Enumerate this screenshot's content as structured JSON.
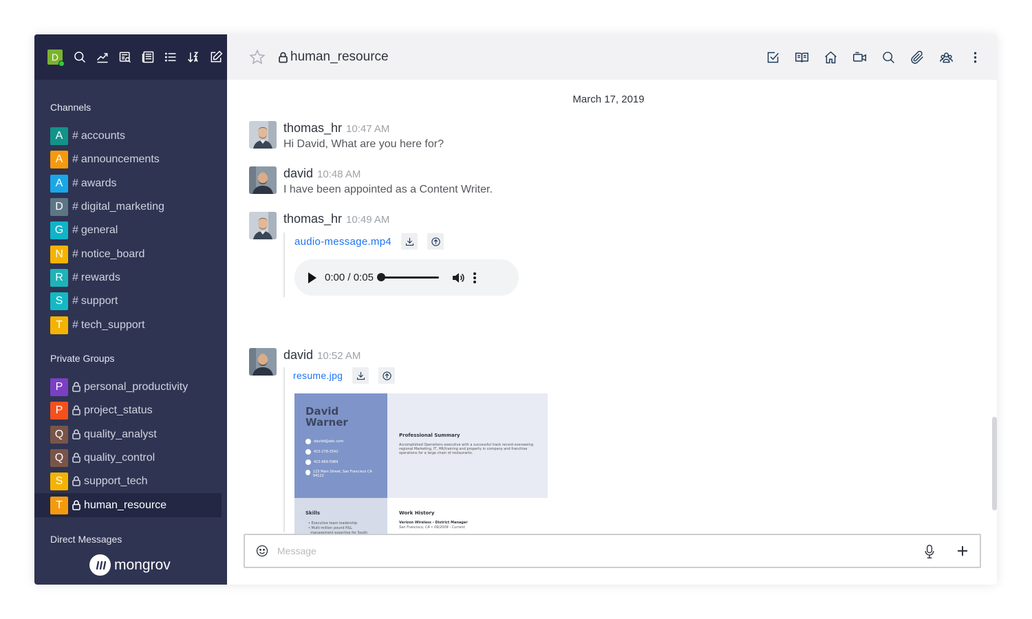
{
  "user": {
    "initial": "D",
    "status_color": "#2ecc40"
  },
  "sidebar_toolbar": [
    {
      "name": "search-icon"
    },
    {
      "name": "trending-icon"
    },
    {
      "name": "directory-icon"
    },
    {
      "name": "news-icon"
    },
    {
      "name": "list-icon"
    },
    {
      "name": "sort-icon"
    },
    {
      "name": "edit-icon"
    }
  ],
  "sidebar": {
    "channels_title": "Channels",
    "channels": [
      {
        "initial": "A",
        "label": "accounts",
        "color": "#12938a"
      },
      {
        "initial": "A",
        "label": "announcements",
        "color": "#f59a0d"
      },
      {
        "initial": "A",
        "label": "awards",
        "color": "#1aa6e8"
      },
      {
        "initial": "D",
        "label": "digital_marketing",
        "color": "#5d7686"
      },
      {
        "initial": "G",
        "label": "general",
        "color": "#10b4c9"
      },
      {
        "initial": "N",
        "label": "notice_board",
        "color": "#f5b300"
      },
      {
        "initial": "R",
        "label": "rewards",
        "color": "#1db3b8"
      },
      {
        "initial": "S",
        "label": "support",
        "color": "#13b9c4"
      },
      {
        "initial": "T",
        "label": "tech_support",
        "color": "#f5b300"
      }
    ],
    "groups_title": "Private Groups",
    "groups": [
      {
        "initial": "P",
        "label": "personal_productivity",
        "color": "#7b3fc4"
      },
      {
        "initial": "P",
        "label": "project_status",
        "color": "#f4511e"
      },
      {
        "initial": "Q",
        "label": "quality_analyst",
        "color": "#795548"
      },
      {
        "initial": "Q",
        "label": "quality_control",
        "color": "#795548"
      },
      {
        "initial": "S",
        "label": "support_tech",
        "color": "#f5b300"
      },
      {
        "initial": "T",
        "label": "human_resource",
        "color": "#f59a0d",
        "active": true
      }
    ],
    "dm_title": "Direct Messages",
    "brand": "mongrov"
  },
  "header": {
    "room_name": "human_resource",
    "icons": [
      "tasks-icon",
      "book-icon",
      "home-icon",
      "video-icon",
      "search-icon",
      "attachment-icon",
      "members-icon",
      "kebab-menu-icon"
    ]
  },
  "date_separator": "March 17, 2019",
  "messages": [
    {
      "user": "thomas_hr",
      "time": "10:47 AM",
      "text": "Hi David, What are you here for?"
    },
    {
      "user": "david",
      "time": "10:48 AM",
      "text": "I have been appointed as a Content Writer."
    },
    {
      "user": "thomas_hr",
      "time": "10:49 AM",
      "file": "audio-message.mp4",
      "audio": {
        "current": "0:00",
        "duration": "0:05",
        "separator": " / "
      }
    },
    {
      "user": "david",
      "time": "10:52 AM",
      "file": "resume.jpg"
    }
  ],
  "resume": {
    "name": "David Warner",
    "contacts": [
      "davidd@abc.com",
      "415-278-2542",
      "415-669-5989",
      "123 Main Street, San Francisco CA 94122"
    ],
    "summary_title": "Professional Summary",
    "summary": "Accomplished Operations executive with a successful track record overseeing regional Marketing, IT, HR/training and property in company and franchise operations for a large chain of restaurants.",
    "skills_title": "Skills",
    "skills": [
      "Executive team leadership",
      "Multi-million pound P&L",
      "management expertise for South"
    ],
    "work_title": "Work History",
    "work_role": "Verizon Wireless - District Manager",
    "work_place": "San Francisco, CA • 09/2009 - Current"
  },
  "composer": {
    "placeholder": "Message"
  }
}
